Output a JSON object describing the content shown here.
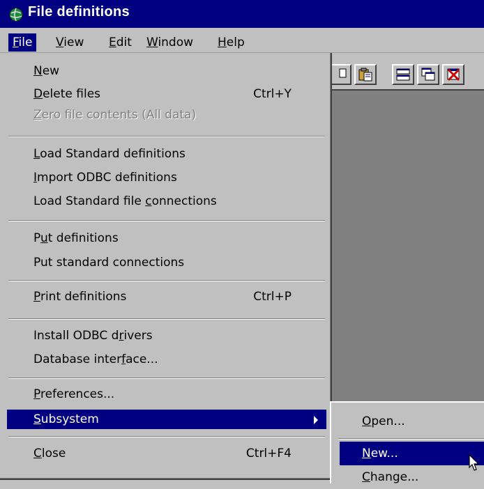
{
  "window": {
    "title": "File definitions",
    "icon": "globe-icon"
  },
  "menubar": {
    "items": [
      {
        "label": "File",
        "mnemonic": "F",
        "active": true
      },
      {
        "label": "View",
        "mnemonic": "V"
      },
      {
        "label": "Edit",
        "mnemonic": "E"
      },
      {
        "label": "Window",
        "mnemonic": "W"
      },
      {
        "label": "Help",
        "mnemonic": "H"
      }
    ]
  },
  "toolbar": {
    "buttons": [
      "copy-icon",
      "paste-icon",
      "tile-windows-icon",
      "cascade-windows-icon",
      "close-window-icon"
    ]
  },
  "file_menu": {
    "items": [
      {
        "id": "new",
        "label": "New",
        "mnemonic": "N",
        "shortcut": ""
      },
      {
        "id": "delete-files",
        "label": "Delete files",
        "mnemonic": "D",
        "shortcut": "Ctrl+Y"
      },
      {
        "id": "zero-file-contents",
        "label": "Zero file contents (All data)",
        "mnemonic": "Z",
        "disabled": true
      },
      {
        "id": "load-standard-definitions",
        "label": "Load Standard definitions",
        "mnemonic": "L"
      },
      {
        "id": "import-odbc-definitions",
        "label": "Import ODBC definitions",
        "mnemonic": "I"
      },
      {
        "id": "load-standard-file-connections",
        "label": "Load Standard file connections",
        "mnemonic": "c"
      },
      {
        "id": "put-definitions",
        "label": "Put definitions",
        "mnemonic": "u"
      },
      {
        "id": "put-standard-connections",
        "label": "Put standard connections"
      },
      {
        "id": "print-definitions",
        "label": "Print definitions",
        "mnemonic": "P",
        "shortcut": "Ctrl+P"
      },
      {
        "id": "install-odbc-drivers",
        "label": "Install ODBC drivers",
        "mnemonic": "r"
      },
      {
        "id": "database-interface",
        "label": "Database interface...",
        "mnemonic": "f"
      },
      {
        "id": "preferences",
        "label": "Preferences...",
        "mnemonic": "P"
      },
      {
        "id": "subsystem",
        "label": "Subsystem",
        "mnemonic": "S",
        "highlighted": true,
        "has_submenu": true
      },
      {
        "id": "close",
        "label": "Close",
        "mnemonic": "C",
        "shortcut": "Ctrl+F4"
      }
    ]
  },
  "subsystem_menu": {
    "items": [
      {
        "id": "open",
        "label": "Open...",
        "mnemonic": "O"
      },
      {
        "id": "new",
        "label": "New...",
        "mnemonic": "N",
        "highlighted": true
      },
      {
        "id": "change",
        "label": "Change...",
        "mnemonic": "C"
      }
    ]
  },
  "colors": {
    "title_bar": "#000080",
    "menu_highlight": "#000080",
    "face": "#c0c0c0",
    "workspace": "#808080"
  }
}
